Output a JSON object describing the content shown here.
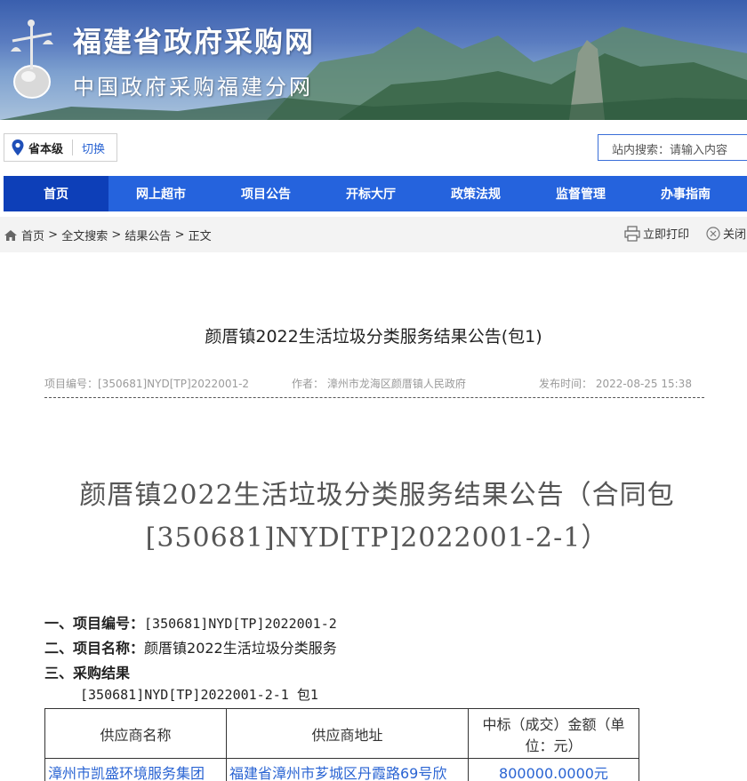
{
  "header": {
    "title": "福建省政府采购网",
    "subtitle": "中国政府采购福建分网"
  },
  "region": {
    "level": "省本级",
    "switch_label": "切换"
  },
  "search": {
    "placeholder": "站内搜索：请输入内容"
  },
  "nav": {
    "items": [
      {
        "label": "首页"
      },
      {
        "label": "网上超市"
      },
      {
        "label": "项目公告"
      },
      {
        "label": "开标大厅"
      },
      {
        "label": "政策法规"
      },
      {
        "label": "监督管理"
      },
      {
        "label": "办事指南"
      }
    ]
  },
  "breadcrumb": {
    "items": [
      "首页",
      "全文搜索",
      "结果公告",
      "正文"
    ],
    "separator": ">"
  },
  "actions": {
    "print_label": "立即打印",
    "close_label": "关闭"
  },
  "article": {
    "title": "颜厝镇2022生活垃圾分类服务结果公告(包1)",
    "meta": {
      "project_no": "项目编号：[350681]NYD[TP]2022001-2",
      "author": "作者：  漳州市龙海区颜厝镇人民政府",
      "published": "发布时间：  2022-08-25 15:38"
    },
    "headline_line1": "颜厝镇2022生活垃圾分类服务结果公告（合同包",
    "headline_line2": "[350681]NYD[TP]2022001-2-1）",
    "sections": {
      "s1_label": "一、项目编号：",
      "s1_value": "[350681]NYD[TP]2022001-2",
      "s2_label": "二、项目名称：",
      "s2_value": "颜厝镇2022生活垃圾分类服务",
      "s3_label": "三、采购结果",
      "package_line": "[350681]NYD[TP]2022001-2-1 包1"
    },
    "table": {
      "headers": [
        "供应商名称",
        "供应商地址",
        "中标（成交）金额（单位：元）"
      ],
      "header_amount_line1": "中标（成交）金额（单",
      "header_amount_line2": "位：元）",
      "rows": [
        {
          "name": "漳州市凯盛环境服务集团",
          "address": "福建省漳州市芗城区丹霞路69号欣",
          "amount": "800000.0000元"
        }
      ]
    }
  },
  "colors": {
    "nav_bg": "#2563dd",
    "nav_active": "#0d3fb8",
    "link": "#2a64d3"
  }
}
